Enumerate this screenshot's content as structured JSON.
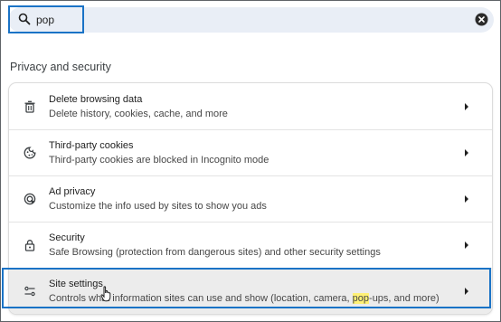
{
  "search": {
    "value": "pop",
    "icon": "search-icon",
    "clear_icon": "close-icon"
  },
  "section": {
    "title": "Privacy and security"
  },
  "rows": [
    {
      "icon": "trash-icon",
      "title": "Delete browsing data",
      "subtitle": "Delete history, cookies, cache, and more"
    },
    {
      "icon": "cookie-icon",
      "title": "Third-party cookies",
      "subtitle": "Third-party cookies are blocked in Incognito mode"
    },
    {
      "icon": "ad-privacy-icon",
      "title": "Ad privacy",
      "subtitle": "Customize the info used by sites to show you ads"
    },
    {
      "icon": "lock-icon",
      "title": "Security",
      "subtitle": "Safe Browsing (protection from dangerous sites) and other security settings"
    },
    {
      "icon": "sliders-icon",
      "title": "Site settings",
      "subtitle_before": "Controls what information sites can use and show (location, camera, ",
      "subtitle_match": "pop",
      "subtitle_after": "-ups, and more)"
    }
  ],
  "colors": {
    "accent_outline": "#1a73c6",
    "search_match_highlight": "#fff176",
    "search_background": "#e9eef6"
  }
}
